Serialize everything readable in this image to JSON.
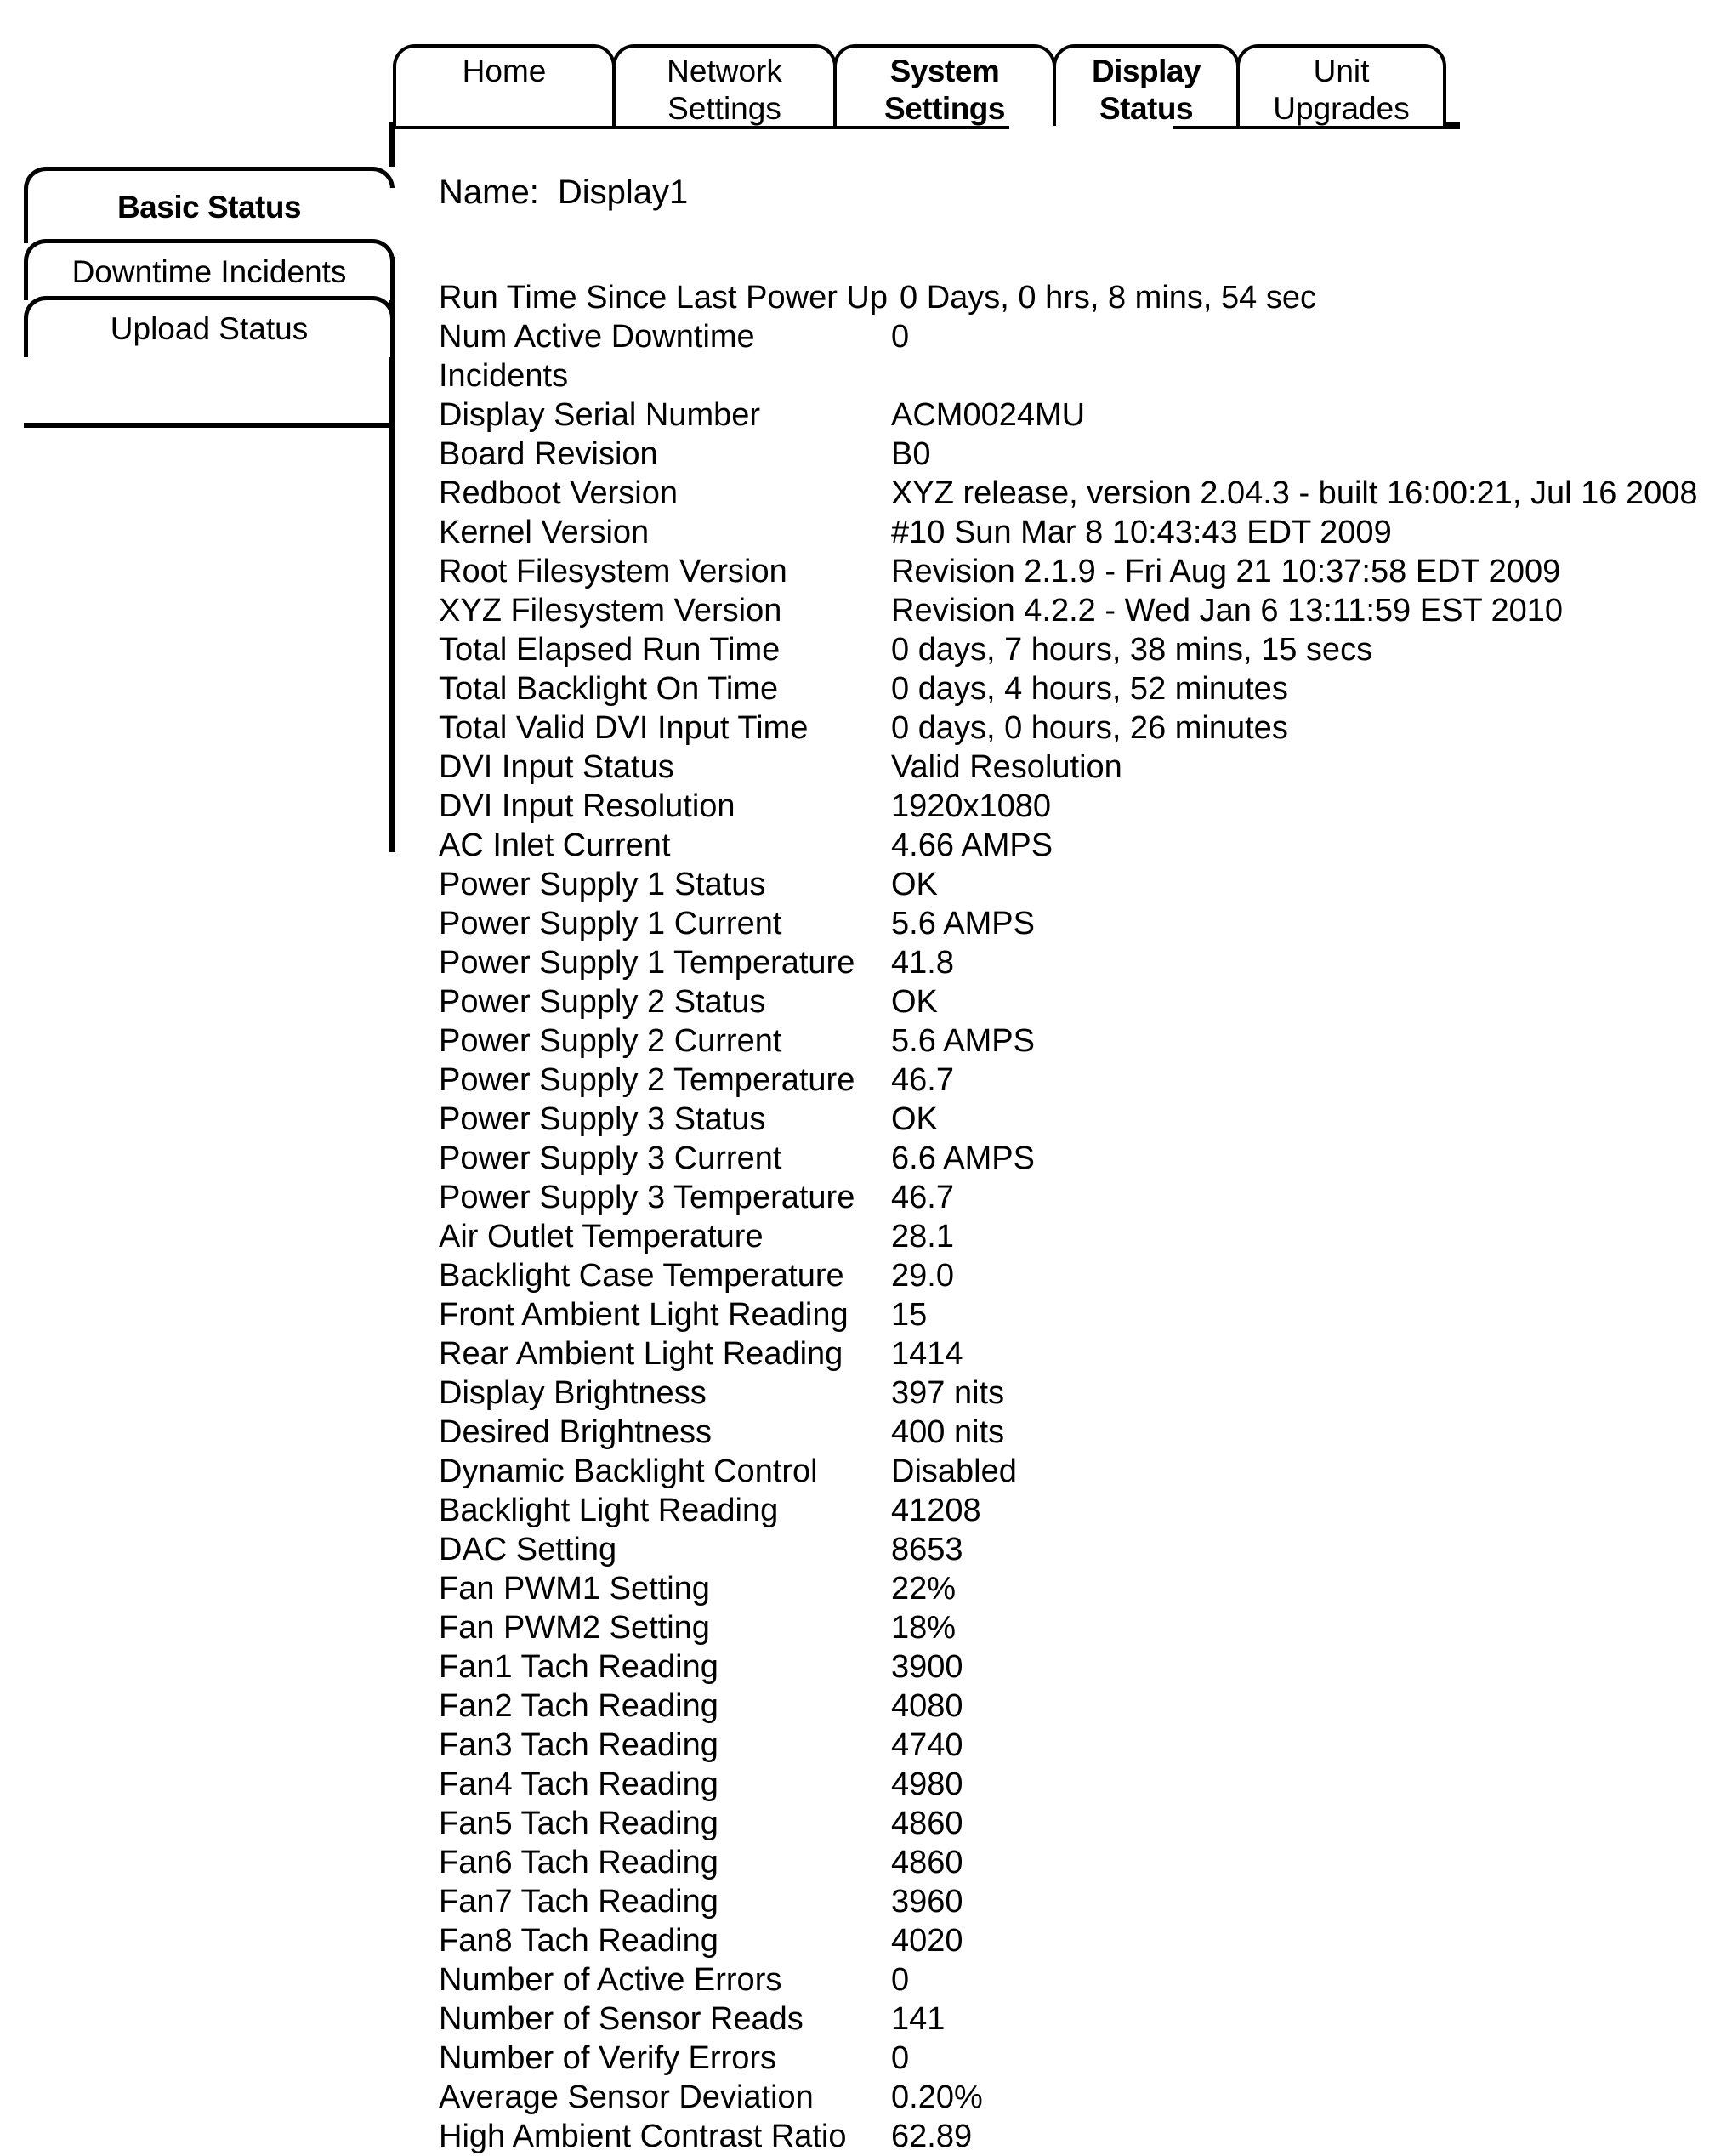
{
  "top_tabs": [
    {
      "line1": "Home",
      "line2": "",
      "selected": false
    },
    {
      "line1": "Network",
      "line2": "Settings",
      "selected": false
    },
    {
      "line1": "System",
      "line2": "Settings",
      "selected": true
    },
    {
      "line1": "Display",
      "line2": "Status",
      "selected": true
    },
    {
      "line1": "Unit",
      "line2": "Upgrades",
      "selected": false
    }
  ],
  "sidebar": {
    "items": [
      {
        "label": "Basic Status",
        "selected": true
      },
      {
        "label": "Downtime Incidents",
        "selected": false
      },
      {
        "label": "Upload Status",
        "selected": false
      }
    ]
  },
  "main": {
    "name_label": "Name:",
    "name_value": "Display1",
    "rows": [
      {
        "label": "Run Time Since Last Power Up",
        "value": "0 Days, 0 hrs, 8 mins, 54 sec",
        "inline": true
      },
      {
        "label": "Num Active Downtime",
        "value": "0"
      },
      {
        "label": "Incidents",
        "value": "",
        "continuation": true
      },
      {
        "label": "Display Serial Number",
        "value": "ACM0024MU"
      },
      {
        "label": "Board Revision",
        "value": "B0"
      },
      {
        "label": "Redboot Version",
        "value": "XYZ release, version 2.04.3 - built 16:00:21, Jul 16 2008"
      },
      {
        "label": "Kernel Version",
        "value": "#10 Sun Mar 8 10:43:43 EDT 2009"
      },
      {
        "label": "Root Filesystem Version",
        "value": "Revision 2.1.9 - Fri Aug 21 10:37:58 EDT 2009"
      },
      {
        "label": "XYZ Filesystem Version",
        "value": "Revision 4.2.2 - Wed Jan 6 13:11:59 EST 2010"
      },
      {
        "label": "Total Elapsed Run Time",
        "value": "0 days, 7 hours, 38 mins, 15 secs"
      },
      {
        "label": "Total Backlight On Time",
        "value": "0 days, 4 hours, 52 minutes"
      },
      {
        "label": "Total Valid DVI Input Time",
        "value": "0 days, 0 hours, 26 minutes"
      },
      {
        "label": "DVI Input Status",
        "value": "Valid Resolution"
      },
      {
        "label": "DVI Input Resolution",
        "value": "1920x1080"
      },
      {
        "label": "AC Inlet Current",
        "value": "4.66 AMPS"
      },
      {
        "label": "Power Supply 1 Status",
        "value": "OK"
      },
      {
        "label": "Power Supply 1 Current",
        "value": "5.6 AMPS"
      },
      {
        "label": "Power Supply 1 Temperature",
        "value": "41.8"
      },
      {
        "label": "Power Supply 2 Status",
        "value": "OK"
      },
      {
        "label": "Power Supply 2 Current",
        "value": "5.6 AMPS"
      },
      {
        "label": "Power Supply 2 Temperature",
        "value": "46.7"
      },
      {
        "label": "Power Supply 3 Status",
        "value": "OK"
      },
      {
        "label": "Power Supply 3 Current",
        "value": "6.6 AMPS"
      },
      {
        "label": "Power Supply 3 Temperature",
        "value": "46.7"
      },
      {
        "label": "Air Outlet Temperature",
        "value": "28.1"
      },
      {
        "label": "Backlight Case Temperature",
        "value": "29.0"
      },
      {
        "label": "Front Ambient Light Reading",
        "value": "15"
      },
      {
        "label": "Rear Ambient Light Reading",
        "value": "1414"
      },
      {
        "label": "Display Brightness",
        "value": "397 nits"
      },
      {
        "label": "Desired Brightness",
        "value": "400 nits"
      },
      {
        "label": "Dynamic Backlight Control",
        "value": "Disabled"
      },
      {
        "label": "Backlight Light Reading",
        "value": "41208"
      },
      {
        "label": "DAC Setting",
        "value": "8653"
      },
      {
        "label": "Fan PWM1 Setting",
        "value": "22%"
      },
      {
        "label": "Fan PWM2 Setting",
        "value": "18%"
      },
      {
        "label": "Fan1 Tach Reading",
        "value": "3900"
      },
      {
        "label": "Fan2 Tach Reading",
        "value": "4080"
      },
      {
        "label": "Fan3 Tach Reading",
        "value": "4740"
      },
      {
        "label": "Fan4 Tach Reading",
        "value": "4980"
      },
      {
        "label": "Fan5 Tach Reading",
        "value": "4860"
      },
      {
        "label": "Fan6 Tach Reading",
        "value": "4860"
      },
      {
        "label": "Fan7 Tach Reading",
        "value": "3960"
      },
      {
        "label": "Fan8 Tach Reading",
        "value": "4020"
      },
      {
        "label": "Number of Active Errors",
        "value": "0"
      },
      {
        "label": "Number of Sensor Reads",
        "value": "141"
      },
      {
        "label": "Number of Verify Errors",
        "value": "0"
      },
      {
        "label": "Average Sensor Deviation",
        "value": "0.20%"
      },
      {
        "label": "High Ambient Contrast Ratio",
        "value": "62.89"
      }
    ]
  }
}
